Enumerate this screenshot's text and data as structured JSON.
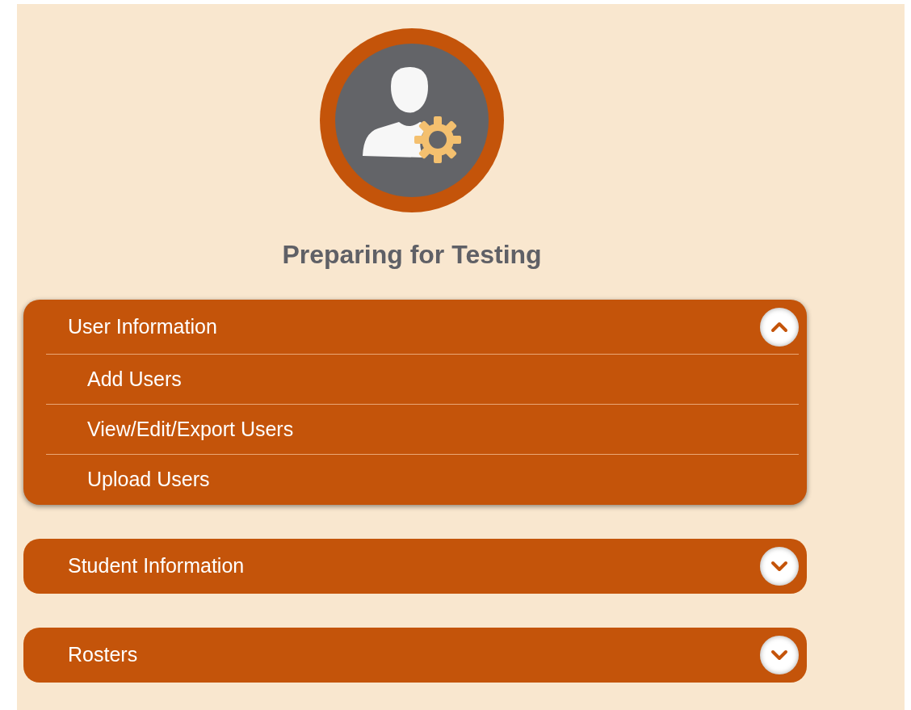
{
  "title": "Preparing for Testing",
  "sections": [
    {
      "label": "User Information",
      "expanded": true,
      "items": [
        "Add Users",
        "View/Edit/Export Users",
        "Upload Users"
      ]
    },
    {
      "label": "Student Information",
      "expanded": false
    },
    {
      "label": "Rosters",
      "expanded": false
    }
  ]
}
